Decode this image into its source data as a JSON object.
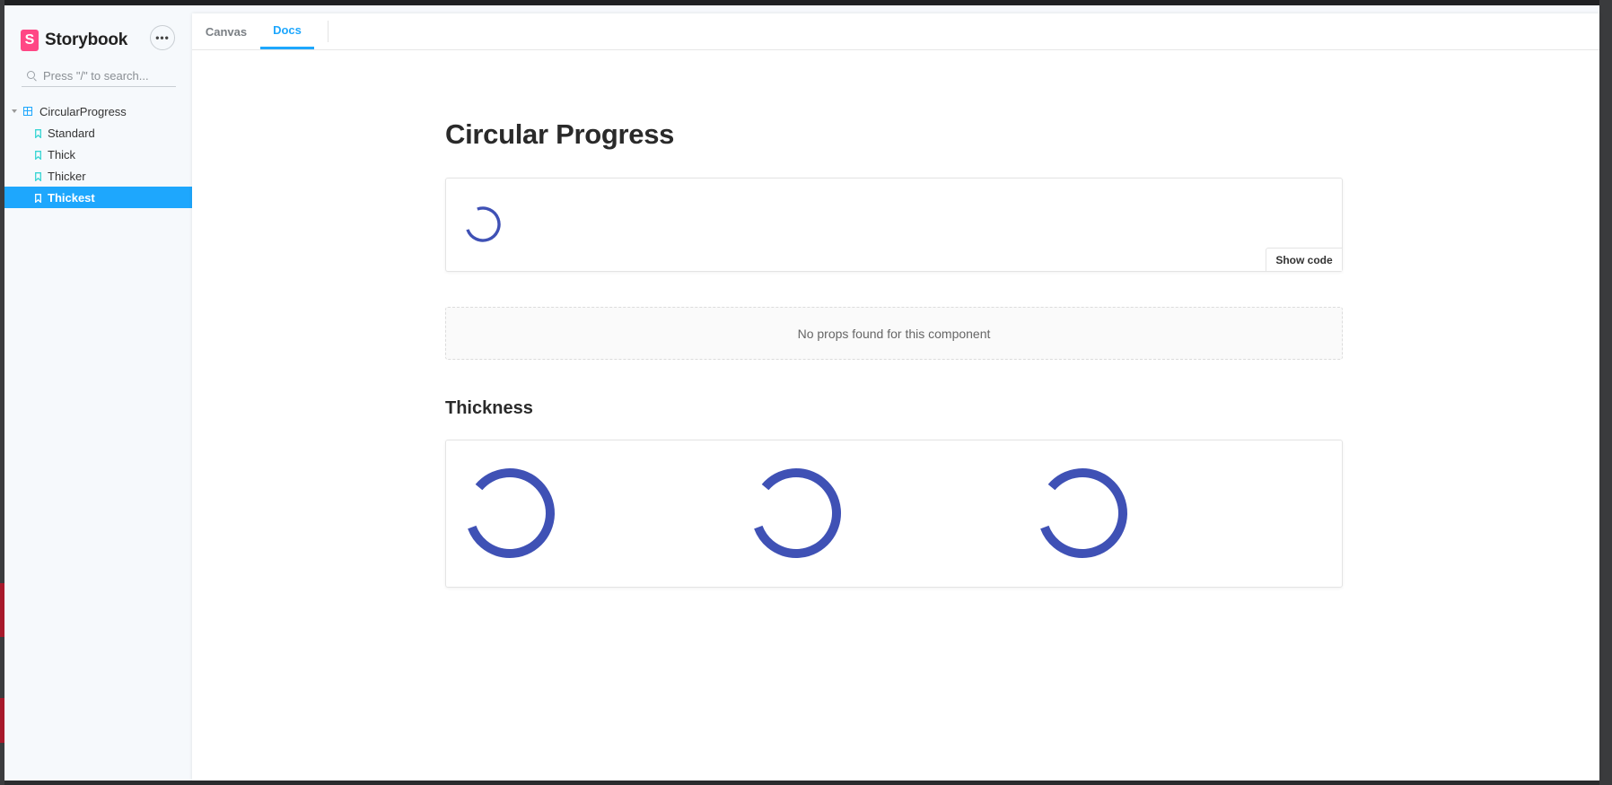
{
  "sidebar": {
    "brand": "Storybook",
    "menu_icon": "ellipsis-icon",
    "search_placeholder": "Press \"/\" to search...",
    "tree": {
      "group": "CircularProgress",
      "stories": [
        "Standard",
        "Thick",
        "Thicker",
        "Thickest"
      ],
      "active": "Thickest"
    }
  },
  "tabs": {
    "canvas": "Canvas",
    "docs": "Docs",
    "active": "Docs"
  },
  "docs": {
    "title": "Circular Progress",
    "show_code": "Show code",
    "no_props": "No props found for this component",
    "section_heading": "Thickness"
  },
  "colors": {
    "accent": "#1ea7fd",
    "brand": "#ff4785",
    "spinner": "#3f51b5"
  }
}
